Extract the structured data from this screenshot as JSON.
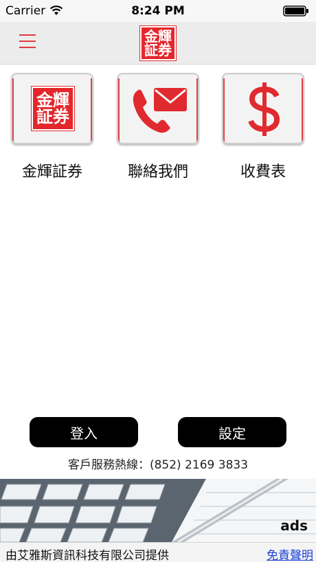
{
  "status_bar": {
    "carrier": "Carrier",
    "time": "8:24 PM",
    "wifi_icon": "wifi-icon",
    "battery_icon": "battery-icon"
  },
  "nav": {
    "menu_icon": "hamburger-menu-icon",
    "logo_line1": "金輝",
    "logo_line2": "証券"
  },
  "tiles": [
    {
      "label": "金輝証券",
      "icon": "company-logo-icon",
      "logo_line1": "金輝",
      "logo_line2": "証券"
    },
    {
      "label": "聯絡我們",
      "icon": "phone-mail-icon"
    },
    {
      "label": "收費表",
      "icon": "dollar-icon"
    }
  ],
  "buttons": {
    "login": "登入",
    "settings": "設定"
  },
  "hotline": "客戶服務熱線：(852) 2169 3833",
  "ad": {
    "label": "ads"
  },
  "footer": {
    "provider": "由艾雅斯資訊科技有限公司提供",
    "disclaimer": "免責聲明"
  },
  "colors": {
    "accent_red": "#e4262b",
    "button_black": "#000000",
    "link_blue": "#1a3fd6"
  }
}
